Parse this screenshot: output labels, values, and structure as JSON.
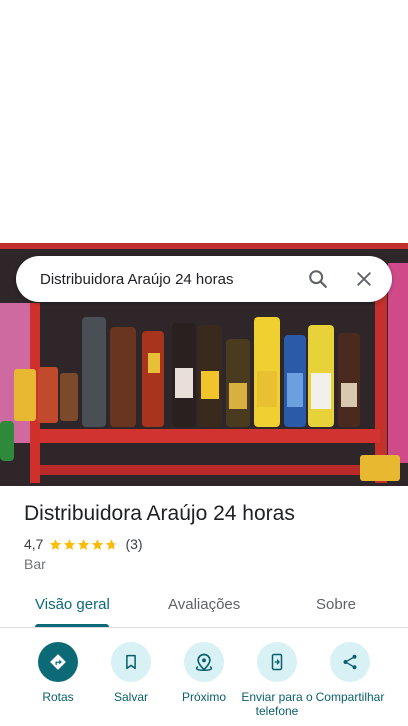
{
  "search": {
    "query": "Distribuidora Araújo 24 horas"
  },
  "place": {
    "name": "Distribuidora Araújo 24 horas",
    "rating": "4,7",
    "rating_stars": 4.7,
    "review_count": "(3)",
    "category": "Bar"
  },
  "tabs": [
    {
      "label": "Visão geral",
      "active": true
    },
    {
      "label": "Avaliações",
      "active": false
    },
    {
      "label": "Sobre",
      "active": false
    }
  ],
  "actions": [
    {
      "label": "Rotas",
      "icon": "directions-icon"
    },
    {
      "label": "Salvar",
      "icon": "bookmark-icon"
    },
    {
      "label": "Próximo",
      "icon": "nearby-icon"
    },
    {
      "label": "Enviar para o telefone",
      "icon": "send-to-phone-icon"
    },
    {
      "label": "Compartilhar",
      "icon": "share-icon"
    }
  ],
  "colors": {
    "accent": "#0b6a76",
    "action_bg": "#d8f1f5",
    "star": "#fbbc04"
  }
}
